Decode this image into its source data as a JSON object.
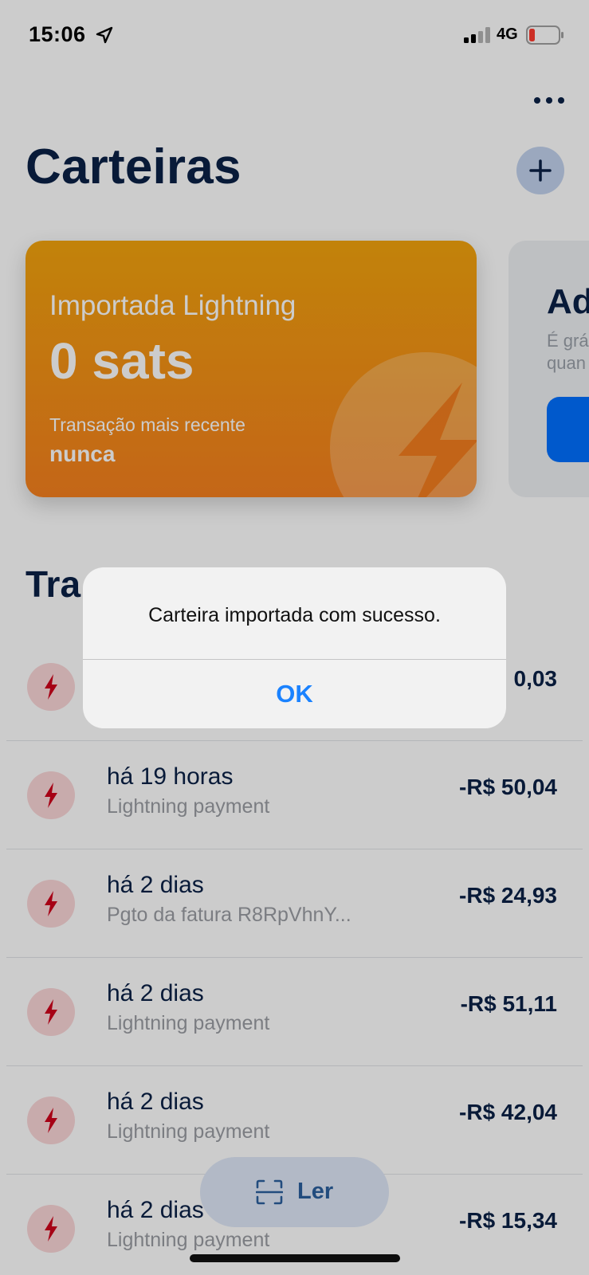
{
  "status_bar": {
    "time": "15:06",
    "network": "4G",
    "icons": [
      "location-arrow-icon",
      "signal-icon",
      "battery-low-icon"
    ]
  },
  "header": {
    "title": "Carteiras",
    "more_icon": "ellipsis-icon",
    "add_icon": "plus-icon"
  },
  "wallet_cards": [
    {
      "name": "Importada Lightning",
      "balance": "0 sats",
      "latest_label": "Transação mais recente",
      "latest_value": "nunca",
      "icon": "lightning-bolt-icon"
    },
    {
      "title_partial": "Ad",
      "desc_line1_partial": "É grá",
      "desc_line2_partial": "quan"
    }
  ],
  "transactions_section": {
    "title_partial": "Tra"
  },
  "transactions": [
    {
      "time": "",
      "memo": "",
      "amount": "0,03"
    },
    {
      "time": "há 19 horas",
      "memo": "Lightning payment",
      "amount": "-R$ 50,04"
    },
    {
      "time": "há 2 dias",
      "memo": "Pgto da fatura R8RpVhnY...",
      "amount": "-R$ 24,93"
    },
    {
      "time": "há 2 dias",
      "memo": "Lightning payment",
      "amount": "-R$ 51,11"
    },
    {
      "time": "há 2 dias",
      "memo": "Lightning payment",
      "amount": "-R$ 42,04"
    },
    {
      "time": "há 2 dias",
      "memo": "Lightning payment",
      "amount": "-R$ 15,34"
    }
  ],
  "scan_button": {
    "label": "Ler",
    "icon": "scan-icon"
  },
  "alert": {
    "message": "Carteira importada com sucesso.",
    "ok_label": "OK"
  },
  "colors": {
    "navy_text": "#0a2147",
    "card_orange_top": "#f3a40d",
    "card_orange_bottom": "#f5801e",
    "alert_button_blue": "#1a82ff",
    "tx_icon_bg": "#fbd6d8",
    "tx_icon_fg": "#d0021b",
    "scan_button_bg": "#dfe8f8",
    "scan_button_text": "#2b5f9e"
  }
}
